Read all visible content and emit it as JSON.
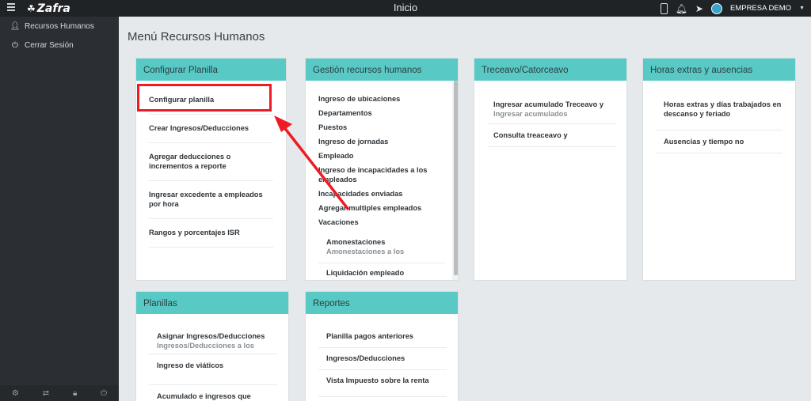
{
  "app": {
    "name": "Zafra",
    "page_title": "Inicio",
    "company": "EMPRESA DEMO"
  },
  "sidebar": {
    "items": [
      {
        "label": "Recursos Humanos",
        "icon": "user-icon"
      },
      {
        "label": "Cerrar Sesión",
        "icon": "power-icon"
      }
    ],
    "bottom_icons": [
      "gear-icon",
      "refresh-icon",
      "lock-icon",
      "power-icon"
    ]
  },
  "main": {
    "title": "Menú Recursos Humanos",
    "cards": {
      "configurar": {
        "header": "Configurar Planilla",
        "items": [
          "Configurar planilla",
          "Crear Ingresos/Deducciones",
          "Agregar deducciones o incrementos a reporte",
          "Ingresar excedente a empleados por hora",
          "Rangos y porcentajes ISR"
        ]
      },
      "gestion": {
        "header": "Gestión recursos humanos",
        "items": [
          "Ingreso de ubicaciones",
          "Departamentos",
          "Puestos",
          "Ingreso de jornadas",
          "Empleado",
          "Ingreso de incapacidades a los empleados",
          "Incapacidades enviadas",
          "Agregar multiples empleados",
          "Vacaciones"
        ],
        "sub_items": [
          {
            "title": "Amonestaciones",
            "sub": "Amonestaciones a los"
          },
          {
            "title": "Liquidación empleado",
            "sub": ""
          }
        ]
      },
      "treceavo": {
        "header": "Treceavo/Catorceavo",
        "items": [
          {
            "title": "Ingresar acumulado Treceavo y",
            "sub": "Ingresar acumulados"
          },
          {
            "title": "Consulta treaceavo y",
            "sub": ""
          }
        ]
      },
      "horas": {
        "header": "Horas extras y ausencias",
        "items": [
          {
            "title": "Horas extras y días trabajados en descanso y feriado",
            "sub": ""
          },
          {
            "title": "Ausencias y tiempo no",
            "sub": ""
          }
        ]
      },
      "planillas": {
        "header": "Planillas",
        "items": [
          {
            "title": "Asignar Ingresos/Deducciones",
            "sub": "Ingresos/Deducciones a los"
          },
          {
            "title": "Ingreso de viáticos",
            "sub": ""
          },
          {
            "title": "Acumulado e ingresos que",
            "sub": ""
          }
        ]
      },
      "reportes": {
        "header": "Reportes",
        "items": [
          "Planilla pagos anteriores",
          "Ingresos/Deducciones",
          "Vista Impuesto sobre la renta"
        ]
      }
    }
  },
  "colors": {
    "accent": "#58c9c4",
    "highlight": "#ee1b24",
    "sidebar": "#2b2f33",
    "topbar": "#1f2326"
  }
}
